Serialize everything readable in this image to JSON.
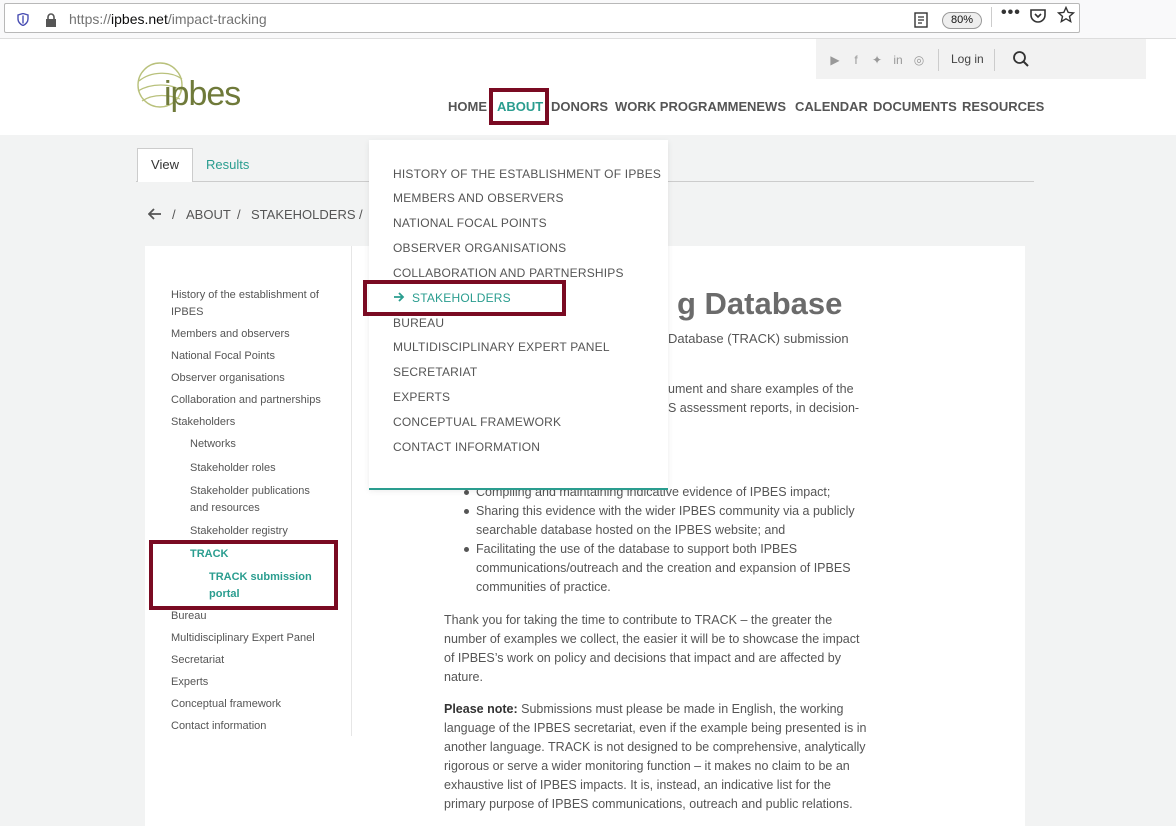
{
  "browser": {
    "url_prefix": "https://",
    "url_domain": "ipbes.net",
    "url_path": "/impact-tracking",
    "zoom": "80%"
  },
  "header": {
    "logo_text": "ipbes",
    "login": "Log in",
    "nav": [
      "HOME",
      "ABOUT",
      "DONORS",
      "WORK PROGRAMME",
      "NEWS",
      "CALENDAR",
      "DOCUMENTS",
      "RESOURCES"
    ],
    "active_nav": "ABOUT"
  },
  "tabs": {
    "view": "View",
    "results": "Results"
  },
  "breadcrumb": [
    "ABOUT",
    "STAKEHOLDERS"
  ],
  "sidebar": {
    "items": [
      "History of the establishment of",
      "IPBES",
      "Members and observers",
      "National Focal Points",
      "Observer organisations",
      "Collaboration and partnerships",
      "Stakeholders",
      "Networks",
      "Stakeholder roles",
      "Stakeholder publications",
      "and resources",
      "Stakeholder registry",
      "TRACK",
      "TRACK submission",
      "portal",
      "Bureau",
      "Multidisciplinary Expert Panel",
      "Secretariat",
      "Experts",
      "Conceptual framework",
      "Contact information"
    ]
  },
  "dropdown": {
    "items": [
      "HISTORY OF THE ESTABLISHMENT OF IPBES",
      "MEMBERS AND OBSERVERS",
      "NATIONAL FOCAL POINTS",
      "OBSERVER ORGANISATIONS",
      "COLLABORATION AND PARTNERSHIPS",
      "STAKEHOLDERS",
      "BUREAU",
      "MULTIDISCIPLINARY EXPERT PANEL",
      "SECRETARIAT",
      "EXPERTS",
      "CONCEPTUAL FRAMEWORK",
      "CONTACT INFORMATION"
    ]
  },
  "main": {
    "title_visible": "g Database",
    "subtitle_visible": "Database (TRACK) submission",
    "intro_lines": [
      "ument and share examples of the",
      "S assessment reports, in decision-"
    ],
    "bullets": [
      [
        "Compiling and maintaining indicative evidence of IPBES impact;"
      ],
      [
        "Sharing this evidence with the wider IPBES community via a publicly",
        "searchable database hosted on the IPBES website; and"
      ],
      [
        "Facilitating the use of the database to support both IPBES",
        "communications/outreach and the creation and expansion of IPBES",
        "communities of practice."
      ]
    ],
    "thanks_lines": [
      "Thank you for taking the time to contribute to TRACK – the greater the",
      "number of examples we collect, the easier it will be to showcase the impact",
      "of IPBES’s work on policy and decisions that impact and are affected by",
      "nature."
    ],
    "note_label": "Please note:",
    "note_lines": [
      " Submissions must please be made in English, the working",
      "language of the IPBES secretariat, even if the example being presented is in",
      "another language. TRACK is not designed to be comprehensive, analytically",
      "rigorous or serve a wider monitoring function – it makes no claim to be an",
      "exhaustive list of IPBES impacts. It is, instead, an indicative list for the",
      "primary purpose of IPBES communications, outreach and public relations."
    ]
  },
  "colors": {
    "accent": "#2a9d8f",
    "highlight": "#7a0a22",
    "logo": "#6f7a3a"
  }
}
